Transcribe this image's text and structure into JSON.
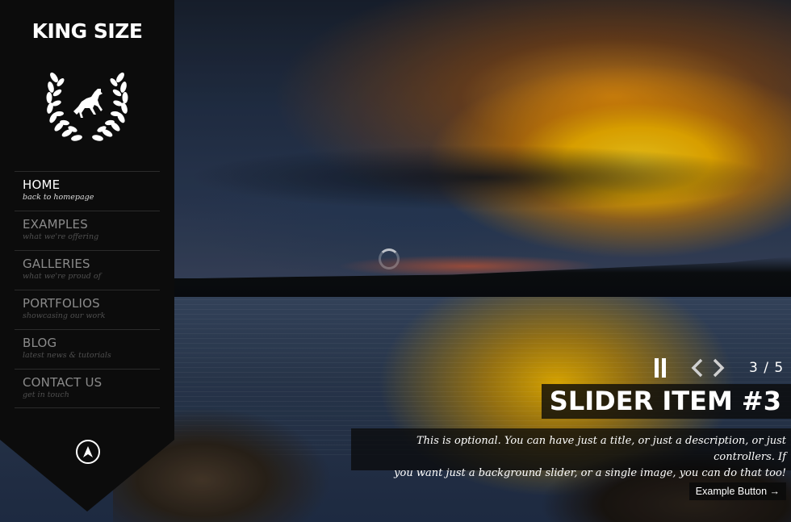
{
  "site": {
    "title": "KING SIZE"
  },
  "menu": [
    {
      "label": "HOME",
      "sub": "back to homepage",
      "active": true
    },
    {
      "label": "EXAMPLES",
      "sub": "what we're offering"
    },
    {
      "label": "GALLERIES",
      "sub": "what we're proud of"
    },
    {
      "label": "PORTFOLIOS",
      "sub": "showcasing our work"
    },
    {
      "label": "BLOG",
      "sub": "latest news & tutorials"
    },
    {
      "label": "CONTACT US",
      "sub": "get in touch"
    }
  ],
  "slider": {
    "counter": "3 / 5",
    "title": "SLIDER ITEM #3",
    "description_line1": "This is optional. You can have just a title, or just a description, or just controllers. If",
    "description_line2": "you want just a background slider, or a single image, you can do that too!",
    "button_label": "Example Button →"
  },
  "icons": {
    "emblem": "laurel-wreath-horse-icon",
    "nav_toggle": "navigation-arrow-icon",
    "pause": "pause-icon",
    "prev": "chevron-left-icon",
    "next": "chevron-right-icon"
  },
  "colors": {
    "sidebar": "#0c0c0c",
    "active_text": "#ffffff",
    "inactive_text": "#8a8a8a"
  }
}
